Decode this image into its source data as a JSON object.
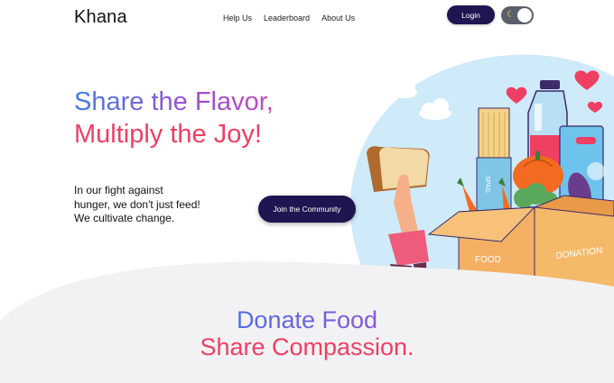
{
  "nav": {
    "logo": "Khana",
    "links": [
      "Help Us",
      "Leaderboard",
      "About Us"
    ],
    "login_label": "Login",
    "theme_icon": "moon-icon"
  },
  "hero": {
    "title_line1": "Share the Flavor,",
    "title_line2": "Multiply the Joy!",
    "subtitle": "In our fight against hunger, we don't just feed! We cultivate change.",
    "cta_label": "Join the Community"
  },
  "illustration": {
    "box_label_left": "FOOD",
    "box_label_right": "DONATION",
    "pasta_label": "SPAG"
  },
  "section": {
    "title_line1": "Donate Food",
    "title_line2": "Share Compassion."
  },
  "colors": {
    "primary_dark": "#1f1550",
    "accent_pink": "#ef3f62",
    "accent_blue": "#3f7fe0",
    "accent_purple": "#9c4fd0",
    "sky_blue": "#cfeaf8",
    "section_gray": "#f2f2f4"
  }
}
